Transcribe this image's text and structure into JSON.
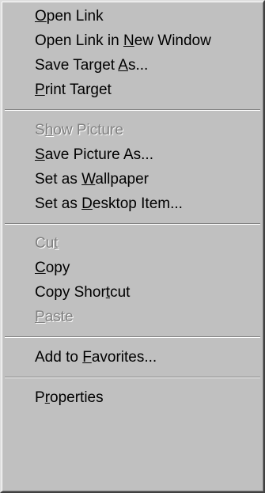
{
  "menu": {
    "items": [
      {
        "pre": "",
        "key": "O",
        "post": "pen Link",
        "disabled": false
      },
      {
        "pre": "Open Link in ",
        "key": "N",
        "post": "ew Window",
        "disabled": false
      },
      {
        "pre": "Save Target ",
        "key": "A",
        "post": "s...",
        "disabled": false
      },
      {
        "pre": "",
        "key": "P",
        "post": "rint Target",
        "disabled": false
      },
      {
        "pre": "S",
        "key": "h",
        "post": "ow Picture",
        "disabled": true
      },
      {
        "pre": "",
        "key": "S",
        "post": "ave Picture As...",
        "disabled": false
      },
      {
        "pre": "Set as ",
        "key": "W",
        "post": "allpaper",
        "disabled": false
      },
      {
        "pre": "Set as ",
        "key": "D",
        "post": "esktop Item...",
        "disabled": false
      },
      {
        "pre": "Cu",
        "key": "t",
        "post": "",
        "disabled": true
      },
      {
        "pre": "",
        "key": "C",
        "post": "opy",
        "disabled": false
      },
      {
        "pre": "Copy Shor",
        "key": "t",
        "post": "cut",
        "disabled": false
      },
      {
        "pre": "",
        "key": "P",
        "post": "aste",
        "disabled": true
      },
      {
        "pre": "Add to ",
        "key": "F",
        "post": "avorites...",
        "disabled": false
      },
      {
        "pre": "P",
        "key": "r",
        "post": "operties",
        "disabled": false
      }
    ]
  }
}
